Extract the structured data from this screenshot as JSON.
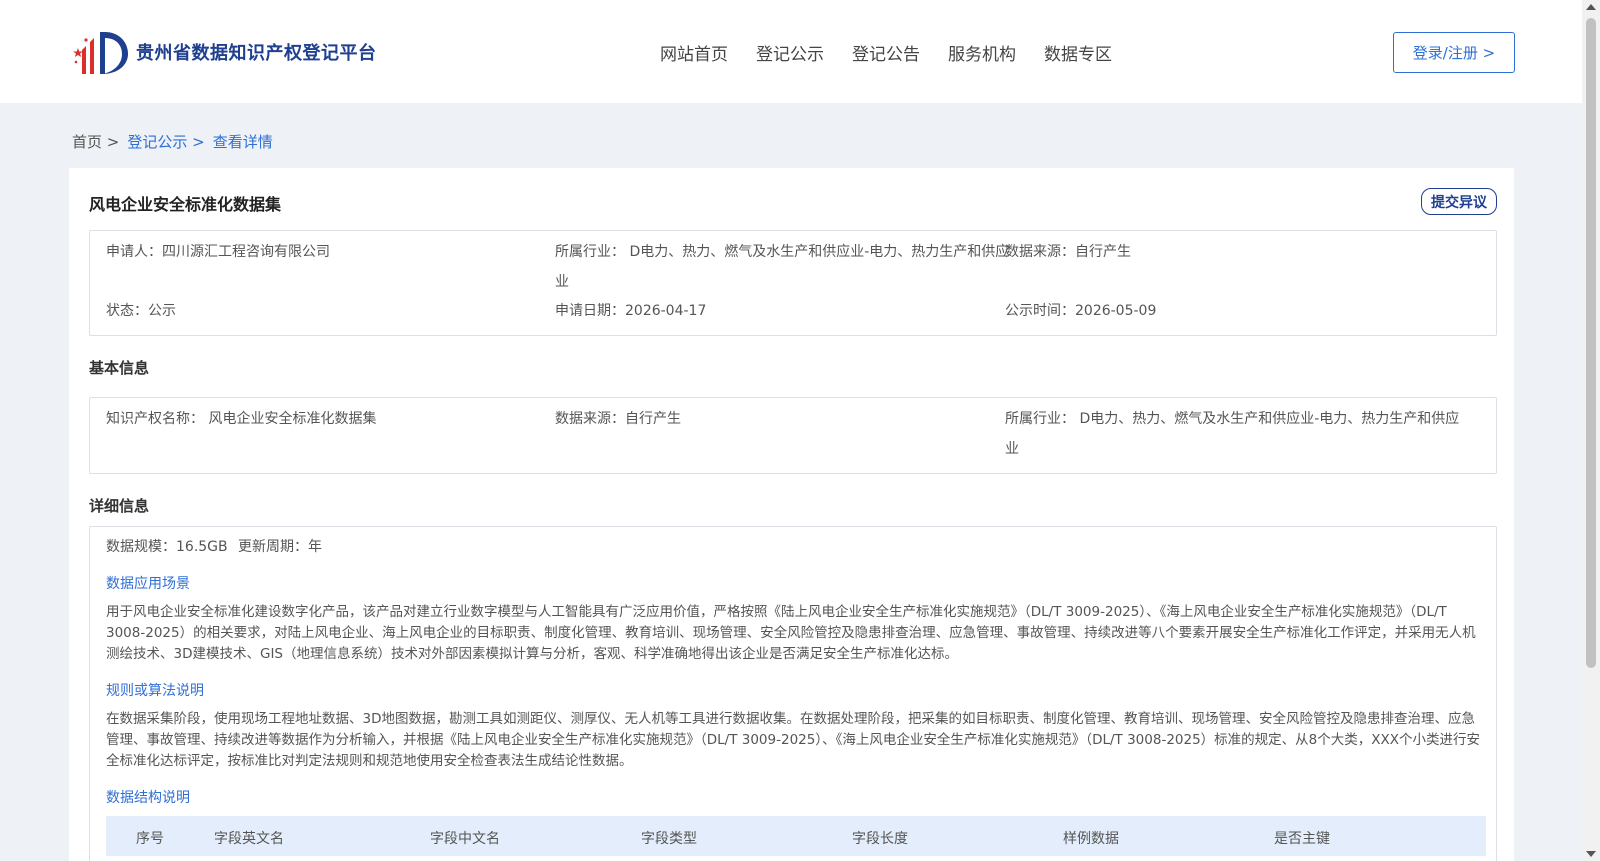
{
  "header": {
    "logo_text": "贵州省数据知识产权登记平台",
    "nav": [
      "网站首页",
      "登记公示",
      "登记公告",
      "服务机构",
      "数据专区"
    ],
    "login_label": "登录/注册 >"
  },
  "breadcrumb": {
    "home": "首页 >",
    "list": "登记公示 >",
    "current": "查看详情"
  },
  "detail": {
    "title": "风电企业安全标准化数据集",
    "objection_label": "提交异议",
    "summary": {
      "applicant": "申请人：四川源汇工程咨询有限公司",
      "industry_line1": "所属行业： D电力、热力、燃气及水生产和供应业-电力、热力生产和供应",
      "industry_line2": "业",
      "source": "数据来源：自行产生",
      "status": "状态：公示",
      "apply_date": "申请日期：2026-04-17",
      "publish_time": "公示时间：2026-05-09"
    },
    "basic": {
      "section_title": "基本信息",
      "ip_name": "知识产权名称： 风电企业安全标准化数据集",
      "source": "数据来源：自行产生",
      "industry_line1": "所属行业： D电力、热力、燃气及水生产和供应业-电力、热力生产和供应",
      "industry_line2": "业"
    },
    "details": {
      "section_title": "详细信息",
      "scale": "数据规模：16.5GB",
      "cycle": "更新周期：年",
      "scenario_title": "数据应用场景",
      "scenario_text": "用于风电企业安全标准化建设数字化产品，该产品对建立行业数字模型与人工智能具有广泛应用价值，严格按照《陆上风电企业安全生产标准化实施规范》（DL/T 3009-2025）、《海上风电企业安全生产标准化实施规范》（DL/T 3008-2025）的相关要求，对陆上风电企业、海上风电企业的目标职责、制度化管理、教育培训、现场管理、安全风险管控及隐患排查治理、应急管理、事故管理、持续改进等八个要素开展安全生产标准化工作评定，并采用无人机测绘技术、3D建模技术、GIS（地理信息系统）技术对外部因素模拟计算与分析，客观、科学准确地得出该企业是否满足安全生产标准化达标。",
      "rule_title": "规则或算法说明",
      "rule_text": "在数据采集阶段，使用现场工程地址数据、3D地图数据，勘测工具如测距仪、测厚仪、无人机等工具进行数据收集。在数据处理阶段，把采集的如目标职责、制度化管理、教育培训、现场管理、安全风险管控及隐患排查治理、应急管理、事故管理、持续改进等数据作为分析输入，并根据《陆上风电企业安全生产标准化实施规范》（DL/T 3009-2025）、《海上风电企业安全生产标准化实施规范》（DL/T 3008-2025）标准的规定、从8个大类，XXX个小类进行安全标准化达标评定，按标准比对判定法规则和规范地使用安全检查表法生成结论性数据。",
      "structure_title": "数据结构说明",
      "table_headers": [
        "序号",
        "字段英文名",
        "字段中文名",
        "字段类型",
        "字段长度",
        "样例数据",
        "是否主键"
      ]
    }
  }
}
